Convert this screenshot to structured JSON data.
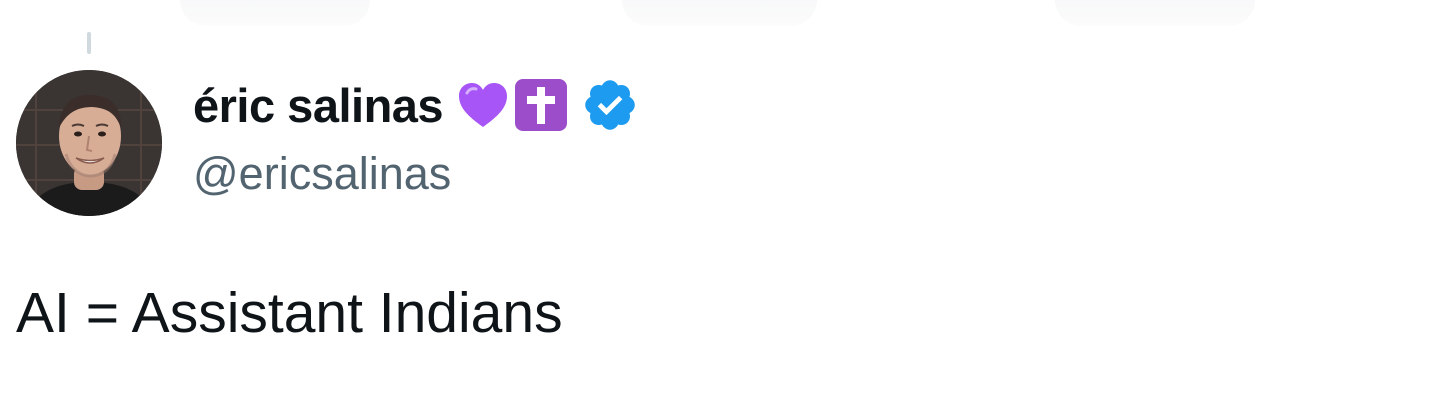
{
  "tweet": {
    "author": {
      "display_name": "éric salinas",
      "handle": "@ericsalinas",
      "verified": true,
      "name_emojis": [
        "purple-heart",
        "latin-cross"
      ]
    },
    "text": "AI = Assistant Indians"
  },
  "colors": {
    "text_primary": "#0f1419",
    "text_secondary": "#536471",
    "verified_badge": "#1d9bf0",
    "heart": "#a855f7",
    "cross_box": "#9b4dca"
  }
}
